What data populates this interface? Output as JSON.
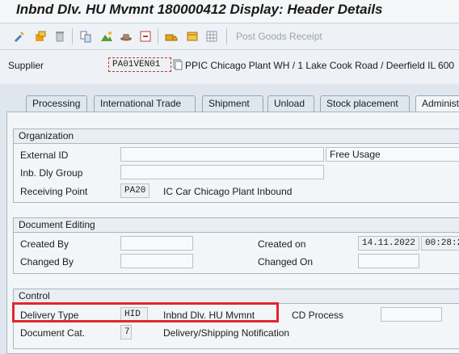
{
  "window": {
    "title": "Inbnd Dlv. HU Mvmnt 180000412 Display: Header Details"
  },
  "toolbar": {
    "icons": [
      "display-change-icon",
      "other-delivery-icon",
      "delete-icon",
      "document-flow-icon",
      "status-overview-icon",
      "hat-icon",
      "output-icon",
      "deliveries-icon",
      "packing-icon",
      "grid-icon"
    ],
    "post_goods_receipt_label": "Post Goods Receipt"
  },
  "header": {
    "supplier_label": "Supplier",
    "supplier_value": "PA01VEN01",
    "supplier_desc": "PPIC Chicago Plant WH / 1 Lake Cook Road / Deerfield IL 600"
  },
  "tabs": [
    "Processing",
    "International Trade",
    "Shipment",
    "Unload",
    "Stock placement",
    "Administ"
  ],
  "organization": {
    "title": "Organization",
    "external_id_label": "External ID",
    "external_id_value": "",
    "free_usage_label": "Free Usage",
    "inb_dly_group_label": "Inb. Dly Group",
    "inb_dly_group_value": "",
    "receiving_point_label": "Receiving Point",
    "receiving_point_value": "PA20",
    "receiving_point_desc": "IC Car Chicago Plant Inbound"
  },
  "document_editing": {
    "title": "Document Editing",
    "created_by_label": "Created By",
    "created_by_value": "",
    "changed_by_label": "Changed By",
    "changed_by_value": "",
    "created_on_label": "Created on",
    "created_on_date": "14.11.2022",
    "created_on_time": "00:28:2",
    "changed_on_label": "Changed On",
    "changed_on_value": ""
  },
  "control": {
    "title": "Control",
    "delivery_type_label": "Delivery Type",
    "delivery_type_value": "HID",
    "delivery_type_desc": "Inbnd Dlv. HU Mvmnt",
    "cd_process_label": "CD Process",
    "cd_process_value": "",
    "document_cat_label": "Document Cat.",
    "document_cat_value": "7",
    "document_cat_desc": "Delivery/Shipping Notification"
  },
  "colors": {
    "highlight": "#e3262d",
    "background": "#dfe6ee"
  }
}
